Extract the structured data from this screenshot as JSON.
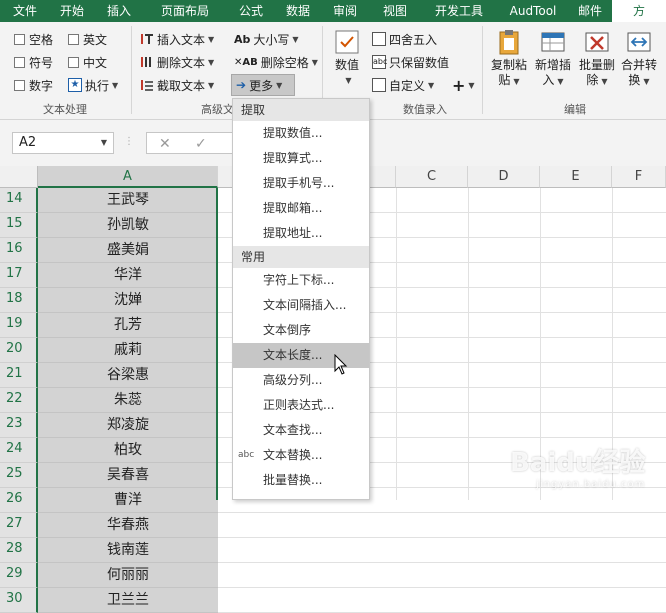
{
  "tabs": [
    "文件",
    "开始",
    "插入",
    "页面布局",
    "公式",
    "数据",
    "审阅",
    "视图",
    "开发工具",
    "AudTool",
    "邮件",
    "方"
  ],
  "ribbon": {
    "text_group": {
      "label": "文本处理",
      "checks": [
        "空格",
        "英文",
        "符号",
        "中文",
        "数字",
        "执行"
      ]
    },
    "advanced_group": {
      "label": "高级文本",
      "insert_text": "插入文本",
      "delete_text": "删除文本",
      "extract_text": "截取文本",
      "case": "大小写",
      "delete_space": "删除空格",
      "more": "更多"
    },
    "number_group": {
      "label": "数值录入",
      "numeric": "数值",
      "round": "四舍五入",
      "keep_value": "只保留数值",
      "custom": "自定义"
    },
    "edit_group": {
      "label": "编辑",
      "copy_paste": [
        "复制粘",
        "贴"
      ],
      "insert": [
        "新增插",
        "入"
      ],
      "batch_delete": [
        "批量删",
        "除"
      ],
      "merge": [
        "合并转",
        "换"
      ]
    }
  },
  "formula_bar": {
    "name_box": "A2",
    "cancel": "✕",
    "confirm": "✓"
  },
  "grid": {
    "columns": [
      "A",
      "C",
      "D",
      "E",
      "F"
    ],
    "rows": [
      {
        "num": "14",
        "value": "王武琴"
      },
      {
        "num": "15",
        "value": "孙凯敏"
      },
      {
        "num": "16",
        "value": "盛美娟"
      },
      {
        "num": "17",
        "value": "华洋"
      },
      {
        "num": "18",
        "value": "沈婵"
      },
      {
        "num": "19",
        "value": "孔芳"
      },
      {
        "num": "20",
        "value": "戚莉"
      },
      {
        "num": "21",
        "value": "谷梁惠"
      },
      {
        "num": "22",
        "value": "朱蕊"
      },
      {
        "num": "23",
        "value": "郑凌旋"
      },
      {
        "num": "24",
        "value": "柏玫"
      },
      {
        "num": "25",
        "value": "吴春喜"
      },
      {
        "num": "26",
        "value": "曹洋"
      },
      {
        "num": "27",
        "value": "华春燕"
      },
      {
        "num": "28",
        "value": "钱南莲"
      },
      {
        "num": "29",
        "value": "何丽丽"
      },
      {
        "num": "30",
        "value": "卫兰兰"
      }
    ]
  },
  "menu": {
    "section1": "提取",
    "extract_items": [
      "提取数值...",
      "提取算式...",
      "提取手机号...",
      "提取邮箱...",
      "提取地址..."
    ],
    "section2": "常用",
    "common_items": [
      "字符上下标...",
      "文本间隔插入...",
      "文本倒序",
      "文本长度...",
      "高级分列...",
      "正则表达式...",
      "文本查找...",
      "文本替换...",
      "批量替换..."
    ],
    "highlighted": "文本长度..."
  },
  "watermark": {
    "brand": "Baidu经验",
    "url": "jingyan.baidu.com"
  },
  "colors": {
    "accent": "#217346",
    "menu_highlight": "#c6c6c6"
  }
}
